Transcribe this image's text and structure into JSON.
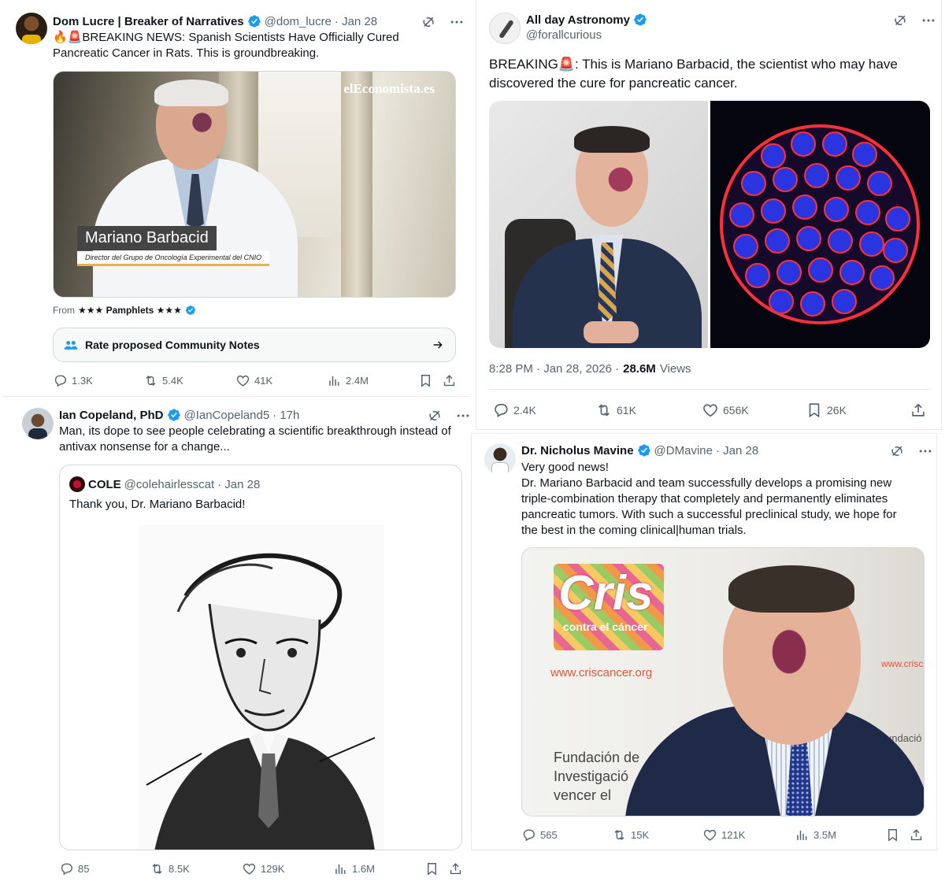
{
  "tweet1": {
    "name": "Dom Lucre | Breaker of Narratives",
    "handle": "@dom_lucre",
    "date": "· Jan 28",
    "text": "🔥🚨BREAKING NEWS: Spanish Scientists Have Officially Cured Pancreatic Cancer in Rats. This is groundbreaking.",
    "media": {
      "watermark": "elEconomista.es",
      "lower_third_name": "Mariano Barbacid",
      "lower_third_title": "Director del Grupo de Oncología Experimental del CNIO"
    },
    "from_label": "From",
    "from_source": "★★★ Pamphlets ★★★",
    "community_notes": "Rate proposed Community Notes",
    "stats": {
      "replies": "1.3K",
      "reposts": "5.4K",
      "likes": "41K",
      "views": "2.4M"
    }
  },
  "tweet2": {
    "name": "All day Astronomy",
    "handle": "@forallcurious",
    "text": "BREAKING🚨: This is Mariano Barbacid, the scientist who may have discovered the cure for pancreatic cancer.",
    "timestamp": "8:28 PM · Jan 28, 2026 ·",
    "views_count": "28.6M",
    "views_label": "Views",
    "stats": {
      "replies": "2.4K",
      "reposts": "61K",
      "likes": "656K",
      "bookmarks": "26K"
    }
  },
  "tweet3": {
    "name": "Ian Copeland, PhD",
    "handle": "@IanCopeland5",
    "date": "· 17h",
    "text": "Man, its dope to see people celebrating a scientific breakthrough instead of antivax nonsense for a change...",
    "quote": {
      "name": "COLE",
      "handle": "@colehairlesscat",
      "date": "· Jan 28",
      "text": "Thank you, Dr. Mariano Barbacid!"
    },
    "stats": {
      "replies": "85",
      "reposts": "8.5K",
      "likes": "129K",
      "views": "1.6M"
    }
  },
  "tweet4": {
    "name": "Dr. Nicholus Mavine",
    "handle": "@DMavine",
    "date": "· Jan 28",
    "text_line1": "Very good news!",
    "text_body": "Dr. Mariano Barbacid and team successfully develops a promising new triple-combination therapy that completely and permanently eliminates pancreatic tumors. With such a successful preclinical study, we hope for the best in the coming clinical|human trials.",
    "media": {
      "logo": "Cris",
      "logo_sub": "contra el cáncer",
      "url": "www.criscancer.org",
      "url_right": "www.crisc",
      "sign_right": "undació",
      "foundation_1": "Fundación de",
      "foundation_2": "Investigació",
      "foundation_3": "vencer el"
    },
    "stats": {
      "replies": "565",
      "reposts": "15K",
      "likes": "121K",
      "views": "3.5M"
    }
  },
  "colors": {
    "verified": "#1d9bf0",
    "text": "#0f1419",
    "muted": "#536471",
    "border": "#e7e9ea"
  }
}
